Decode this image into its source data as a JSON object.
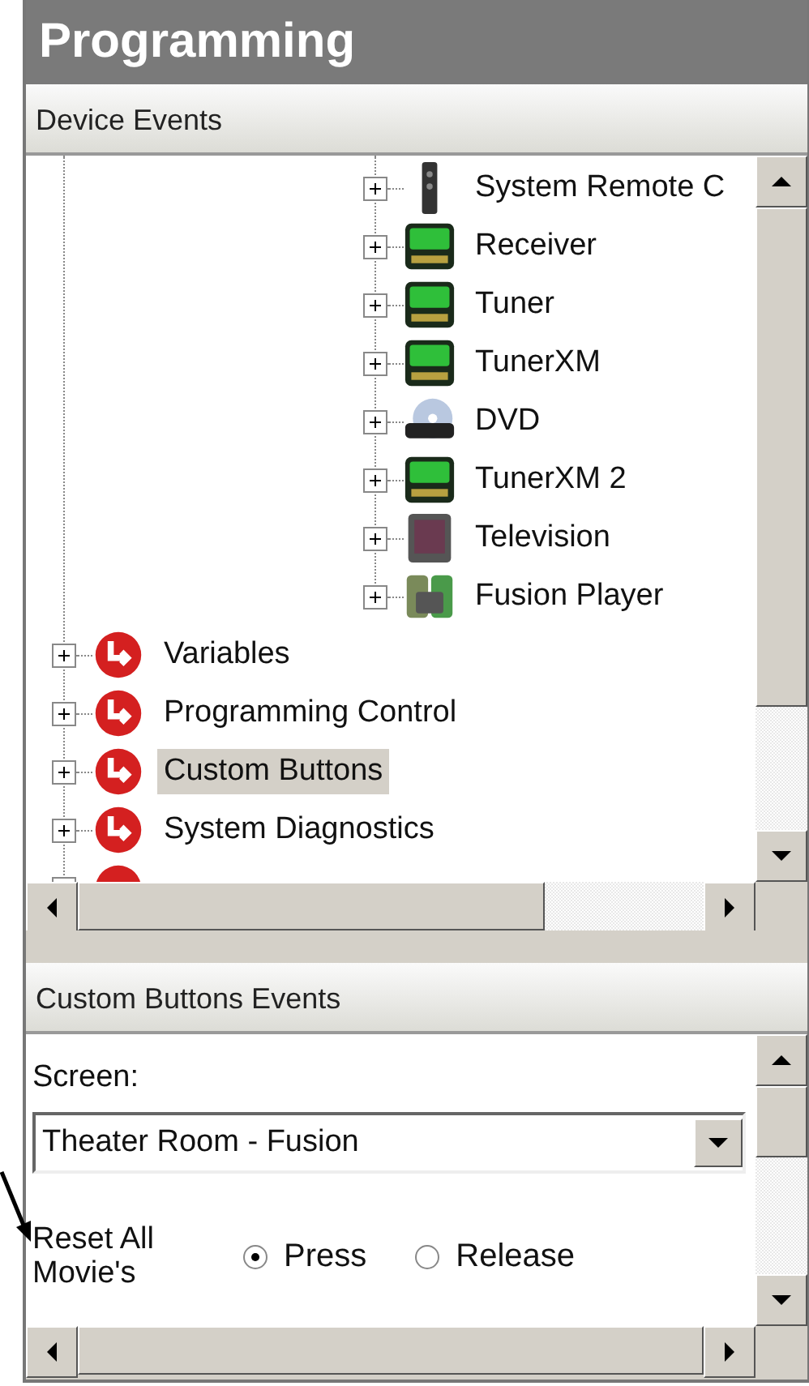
{
  "title": "Programming",
  "device_events": {
    "header": "Device Events",
    "devices": [
      {
        "label": "System Remote C",
        "kind": "remote",
        "selected": false
      },
      {
        "label": "Receiver",
        "kind": "receiver",
        "selected": false
      },
      {
        "label": "Tuner",
        "kind": "receiver",
        "selected": false
      },
      {
        "label": "TunerXM",
        "kind": "receiver",
        "selected": false
      },
      {
        "label": "DVD",
        "kind": "dvd",
        "selected": false
      },
      {
        "label": "TunerXM 2",
        "kind": "receiver",
        "selected": false
      },
      {
        "label": "Television",
        "kind": "tv",
        "selected": false
      },
      {
        "label": "Fusion Player",
        "kind": "player",
        "selected": false
      }
    ],
    "groups": [
      {
        "label": "Variables",
        "selected": false
      },
      {
        "label": "Programming Control",
        "selected": false
      },
      {
        "label": "Custom Buttons",
        "selected": true
      },
      {
        "label": "System Diagnostics",
        "selected": false
      }
    ]
  },
  "custom_events": {
    "header": "Custom Buttons Events",
    "screen_label": "Screen:",
    "screen_value": "Theater Room - Fusion",
    "button_label": "Reset All Movie's",
    "options": [
      {
        "label": "Press",
        "selected": true
      },
      {
        "label": "Release",
        "selected": false
      }
    ]
  }
}
